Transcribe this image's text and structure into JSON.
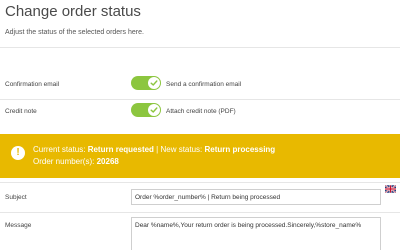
{
  "page": {
    "title": "Change order status",
    "subtitle": "Adjust the status of the selected orders here."
  },
  "options": {
    "confirmation_email": {
      "label": "Confirmation email",
      "toggle_text": "Send a confirmation email",
      "checked": true
    },
    "credit_note": {
      "label": "Credit note",
      "toggle_text": "Attach credit note (PDF)",
      "checked": true
    }
  },
  "banner": {
    "current_label": "Current status:",
    "current_value": "Return requested",
    "separator": "|",
    "new_label": "New status:",
    "new_value": "Return processing",
    "orders_label": "Order number(s):",
    "orders_value": "20268",
    "icon": "exclamation-icon",
    "color": "#e8b900"
  },
  "form": {
    "subject": {
      "label": "Subject",
      "value": "Order %order_number% | Return being processed"
    },
    "message": {
      "label": "Message",
      "value": "Dear %name%,Your return order is being processed.Sincerely,%store_name%"
    },
    "language_icon": "uk-flag-icon"
  },
  "colors": {
    "toggle_on": "#8cc63f",
    "banner": "#e8b900"
  }
}
